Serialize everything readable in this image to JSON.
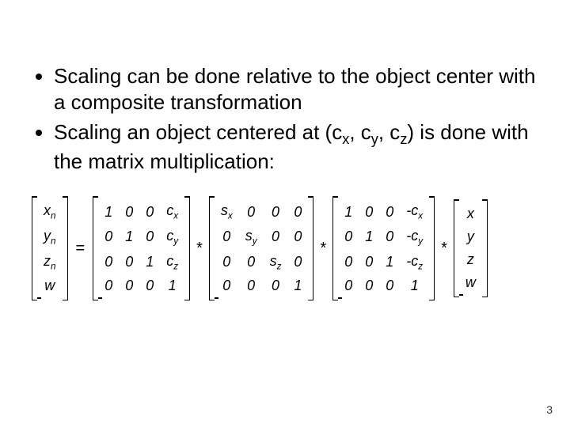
{
  "bullets": [
    {
      "pre": "Scaling can be done relative to the object center with a composite transformation"
    },
    {
      "pre": "Scaling an object centered at (c",
      "s1": "x",
      "mid1": ", c",
      "s2": "y",
      "mid2": ", c",
      "s3": "z",
      "post": ") is done with the matrix multiplication:"
    }
  ],
  "eq": {
    "result_vec": [
      [
        "x",
        "n"
      ],
      [
        "y",
        "n"
      ],
      [
        "z",
        "n"
      ],
      [
        "w",
        ""
      ]
    ],
    "equals": "=",
    "star": "*",
    "T_to": [
      [
        "1",
        "0",
        "0",
        [
          "c",
          "x"
        ]
      ],
      [
        "0",
        "1",
        "0",
        [
          "c",
          "y"
        ]
      ],
      [
        "0",
        "0",
        "1",
        [
          "c",
          "z"
        ]
      ],
      [
        "0",
        "0",
        "0",
        "1"
      ]
    ],
    "S": [
      [
        [
          "s",
          "x"
        ],
        "0",
        "0",
        "0"
      ],
      [
        "0",
        [
          "s",
          "y"
        ],
        "0",
        "0"
      ],
      [
        "0",
        "0",
        [
          "s",
          "z"
        ],
        "0"
      ],
      [
        "0",
        "0",
        "0",
        "1"
      ]
    ],
    "T_back": [
      [
        "1",
        "0",
        "0",
        [
          "-c",
          "x"
        ]
      ],
      [
        "0",
        "1",
        "0",
        [
          "-c",
          "y"
        ]
      ],
      [
        "0",
        "0",
        "1",
        [
          "-c",
          "z"
        ]
      ],
      [
        "0",
        "0",
        "0",
        "1"
      ]
    ],
    "in_vec": [
      [
        "x",
        ""
      ],
      [
        "y",
        ""
      ],
      [
        "z",
        ""
      ],
      [
        "w",
        ""
      ]
    ]
  },
  "page_number": "3"
}
